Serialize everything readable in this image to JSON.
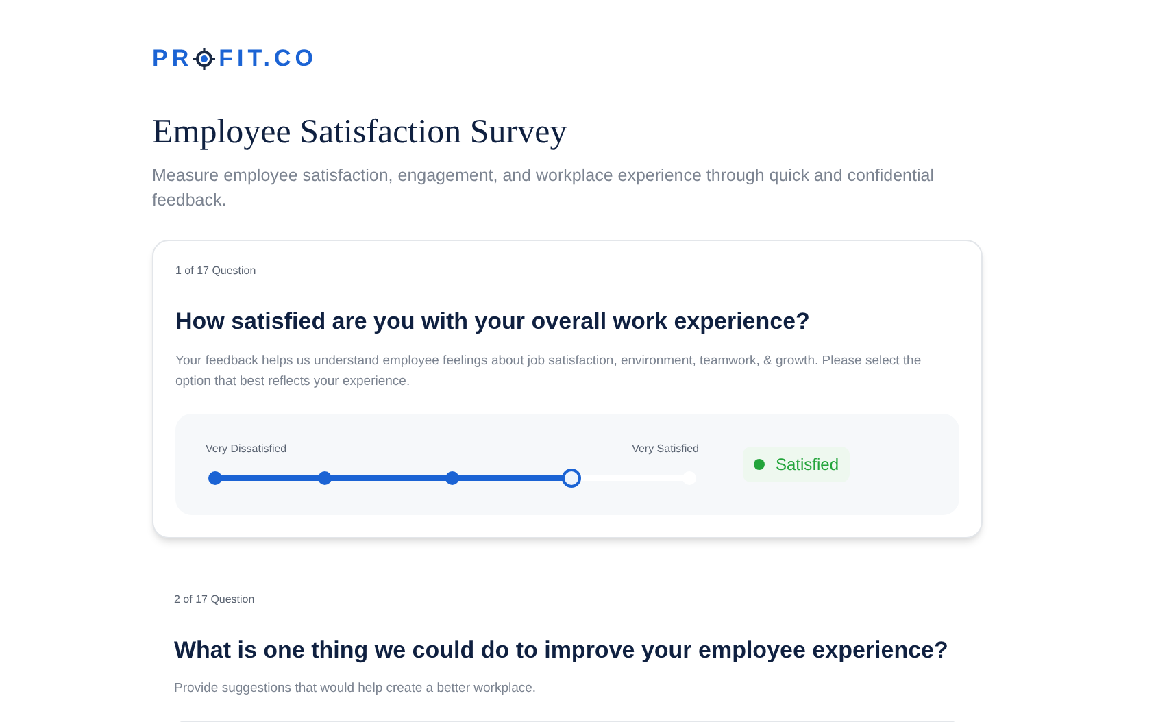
{
  "logo": {
    "before": "PR",
    "after": "FIT.CO"
  },
  "title": "Employee Satisfaction Survey",
  "subtitle": "Measure employee satisfaction, engagement, and workplace experience through quick and confidential feedback.",
  "questions": [
    {
      "kind": "scale",
      "counter": "1 of 17 Question",
      "question": "How satisfied are you with your overall work experience?",
      "description": "Your feedback helps us understand employee feelings about job satisfaction, environment, teamwork, & growth. Please select the option that best reflects your experience.",
      "min_label": "Very Dissatisfied",
      "max_label": "Very Satisfied",
      "level": 0.75,
      "answer": "Satisfied",
      "color": "#22a43a"
    },
    {
      "kind": "text",
      "counter": "2 of 17 Question",
      "question": "What is one thing we could do to improve your employee experience?",
      "description": "Provide suggestions that would help create a better workplace."
    }
  ]
}
